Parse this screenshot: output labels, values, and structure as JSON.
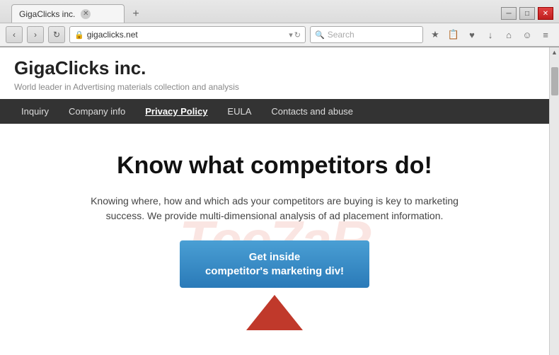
{
  "window": {
    "title": "GigaClicks inc.",
    "tab_label": "GigaClicks inc.",
    "close_label": "✕",
    "minimize_label": "─",
    "maximize_label": "□"
  },
  "addressbar": {
    "url": "gigaclicks.net",
    "search_placeholder": "Search",
    "nav_back": "‹",
    "nav_forward": "›",
    "refresh": "↻"
  },
  "toolbar": {
    "icons": [
      "★",
      "🔒",
      "♥",
      "↓",
      "⌂",
      "☺",
      "≡"
    ]
  },
  "site": {
    "title": "GigaClicks inc.",
    "subtitle": "World leader in Advertising materials collection and analysis",
    "watermark": "Tee7aR",
    "nav": [
      {
        "label": "Inquiry",
        "active": false
      },
      {
        "label": "Company info",
        "active": false
      },
      {
        "label": "Privacy Policy",
        "active": true
      },
      {
        "label": "EULA",
        "active": false
      },
      {
        "label": "Contacts and abuse",
        "active": false
      }
    ],
    "hero": {
      "headline": "Know what competitors do!",
      "body": "Knowing where, how and which ads your competitors are buying is key to marketing success. We provide multi-dimensional analysis of ad placement information.",
      "cta": "Get inside\ncompetitor's marketing div!"
    }
  }
}
